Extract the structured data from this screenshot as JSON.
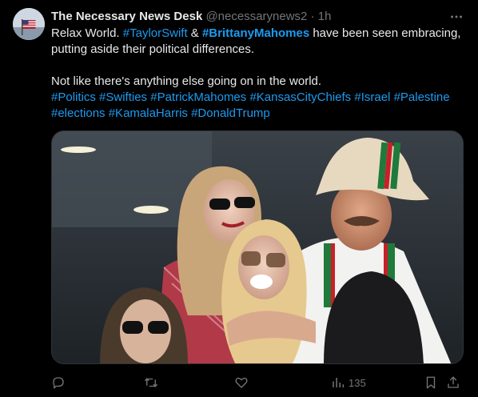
{
  "tweet": {
    "author_name": "The Necessary News Desk",
    "handle": "@necessarynews2",
    "separator": "·",
    "time": "1h",
    "more_icon": "ellipsis-icon",
    "text": {
      "line1_a": "Relax World. ",
      "tag_taylorswift": "#TaylorSwift",
      "line1_b": " & ",
      "tag_brittanymahomes": "#BrittanyMahomes",
      "line1_c": " have been seen embracing, putting aside their political differences.",
      "line2": "Not like there's anything else going on in the world.",
      "tag_politics": "#Politics",
      "tag_swifties": "#Swifties",
      "tag_patrickmahomes": "#PatrickMahomes",
      "tag_kansascitychiefs": "#KansasCityChiefs",
      "tag_israel": "#Israel",
      "tag_palestine": "#Palestine",
      "tag_elections": "#elections",
      "tag_kamalaharris": "#KamalaHarris",
      "tag_donaldtrump": "#DonaldTrump"
    },
    "actions": {
      "reply_icon": "reply-icon",
      "retweet_icon": "retweet-icon",
      "like_icon": "heart-icon",
      "views_icon": "views-icon",
      "views_count": "135",
      "bookmark_icon": "bookmark-icon",
      "share_icon": "share-icon"
    },
    "colors": {
      "background": "#000000",
      "text": "#e7e9ea",
      "muted": "#71767b",
      "link": "#1d9bf0"
    }
  }
}
